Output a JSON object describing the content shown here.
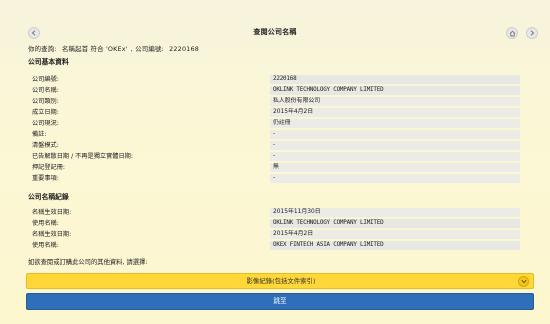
{
  "header": {
    "title": "查閱公司名稱"
  },
  "query": {
    "prefix": "你的查詢:",
    "criteria": "名稱起首 符合 'OKEx'",
    "company_no_label": "公司編號:",
    "company_no": "2220168"
  },
  "sections": {
    "basic_title": "公司基本資料",
    "names_title": "公司名稱紀錄"
  },
  "basic_rows": [
    {
      "label": "公司編號:",
      "value": "2220168"
    },
    {
      "label": "公司名稱:",
      "value": "OKLINK TECHNOLOGY COMPANY LIMITED"
    },
    {
      "label": "公司類別:",
      "value": "私人股份有限公司"
    },
    {
      "label": "成立日期:",
      "value": "2015年4月2日"
    },
    {
      "label": "公司現況:",
      "value": "仍註冊"
    },
    {
      "label": "備註:",
      "value": "-"
    },
    {
      "label": "清盤模式:",
      "value": "-"
    },
    {
      "label": "已告解散日期 / 不再是獨立實體日期:",
      "value": "-"
    },
    {
      "label": "押記登記冊:",
      "value": "無"
    },
    {
      "label": "重要事項:",
      "value": "-"
    }
  ],
  "name_rows": [
    {
      "label": "名稱生效日期:",
      "value": "2015年11月30日"
    },
    {
      "label": "使用名稱:",
      "value": "OKLINK TECHNOLOGY COMPANY LIMITED"
    },
    {
      "label": "名稱生效日期:",
      "value": "2015年4月2日"
    },
    {
      "label": "使用名稱:",
      "value": "OKEX FINTECH ASIA COMPANY LIMITED"
    }
  ],
  "hint": "如欲查閱或訂購此公司的其他資料, 請選擇:",
  "actions": {
    "image_records_label": "影像紀錄(包括文件索引)",
    "next_label": "跳至"
  },
  "icons": {
    "back": "back-arrow-icon",
    "home": "home-icon",
    "forward": "forward-arrow-icon",
    "expand": "chevron-down-icon"
  },
  "colors": {
    "accordion": "#ffd737",
    "primary_button": "#2d6fb8",
    "value_cell": "#e7e7e4"
  }
}
